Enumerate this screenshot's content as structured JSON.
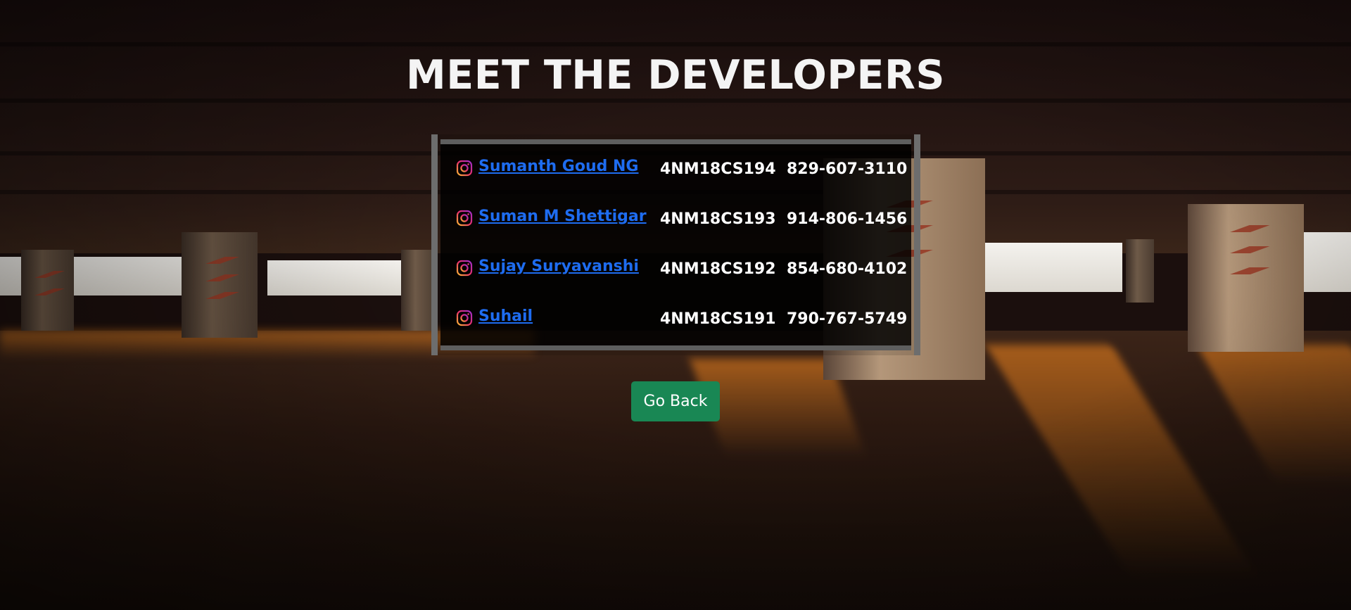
{
  "page": {
    "title": "MEET THE DEVELOPERS"
  },
  "developers": [
    {
      "name": "Sumanth Goud NG",
      "usn": "4NM18CS194",
      "phone": "829-607-3110",
      "icon": "instagram-icon"
    },
    {
      "name": "Suman M Shettigar",
      "usn": "4NM18CS193",
      "phone": "914-806-1456",
      "icon": "instagram-icon"
    },
    {
      "name": "Sujay Suryavanshi",
      "usn": "4NM18CS192",
      "phone": "854-680-4102",
      "icon": "instagram-icon"
    },
    {
      "name": "Suhail",
      "usn": "4NM18CS191",
      "phone": "790-767-5749",
      "icon": "instagram-icon"
    }
  ],
  "actions": {
    "go_back_label": "Go Back"
  },
  "colors": {
    "title_text": "#f4f4f4",
    "link": "#1e6cf0",
    "button_bg": "#198754",
    "table_bg": "#000000",
    "table_border": "#6d6d6d"
  }
}
